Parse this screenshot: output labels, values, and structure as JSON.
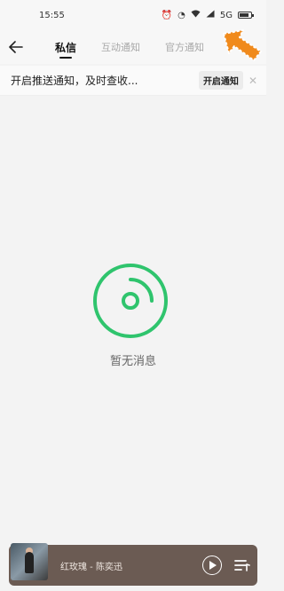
{
  "status_bar": {
    "time": "15:55",
    "network_label": "5G",
    "battery_level": 0.75
  },
  "header": {
    "tabs": [
      {
        "label": "私信",
        "active": true
      },
      {
        "label": "互动通知",
        "active": false
      },
      {
        "label": "官方通知",
        "active": false
      }
    ]
  },
  "notice": {
    "text": "开启推送通知，及时查收...",
    "button": "开启通知"
  },
  "empty": {
    "text": "暂无消息"
  },
  "player": {
    "song": "红玫瑰 - 陈奕迅"
  },
  "colors": {
    "accent": "#2fc46d",
    "player_bg": "#6b5b53",
    "arrow": "#f08a1c"
  }
}
